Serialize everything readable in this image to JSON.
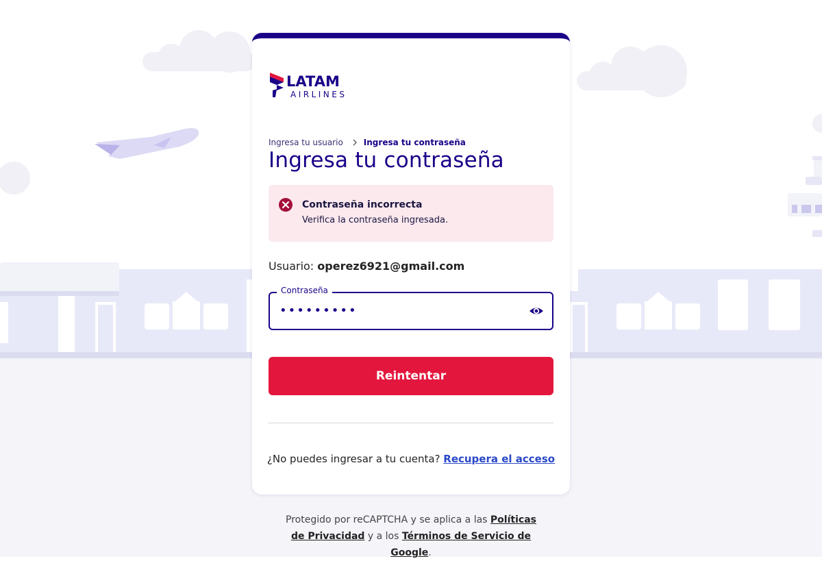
{
  "brand": {
    "name": "LATAM",
    "subtitle": "AIRLINES"
  },
  "breadcrumb": {
    "step1": "Ingresa tu usuario",
    "step2": "Ingresa tu contraseña"
  },
  "page_title": "Ingresa tu contraseña",
  "alert": {
    "title": "Contraseña incorrecta",
    "message": "Verifica la contraseña ingresada."
  },
  "user": {
    "label": "Usuario:",
    "email": "operez6921@gmail.com"
  },
  "password": {
    "label": "Contraseña",
    "value": "•••••••••"
  },
  "retry_button": "Reintentar",
  "recover": {
    "text": "¿No puedes ingresar a tu cuenta?",
    "link": "Recupera el acceso"
  },
  "recaptcha": {
    "text1": "Protegido por reCAPTCHA y se aplica a las",
    "privacy_link": "Políticas de Privacidad",
    "text2": "y a los",
    "terms_link": "Términos de Servicio de Google",
    "end": "."
  },
  "colors": {
    "primary": "#1b0088",
    "accent": "#e3173e",
    "alert_bg": "#fbe9ee",
    "link": "#2a48c8"
  }
}
